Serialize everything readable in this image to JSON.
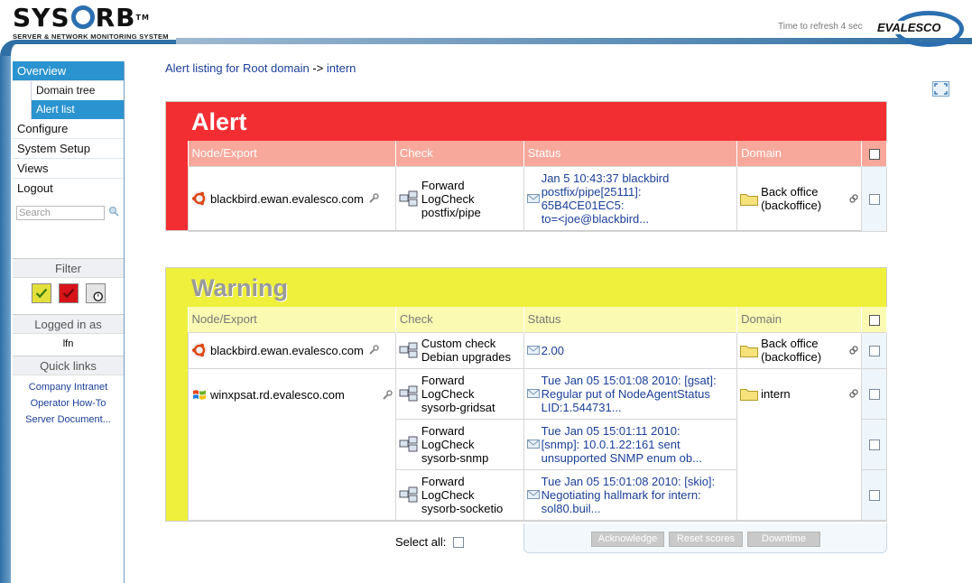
{
  "header": {
    "brand_left": "SYS",
    "brand_right": "RB",
    "trademark": "TM",
    "subtitle": "SERVER & NETWORK MONITORING SYSTEM",
    "refresh_text": "Time to refresh 4 sec",
    "partner": "EVALESCO"
  },
  "sidebar": {
    "nav": [
      {
        "label": "Overview"
      },
      {
        "label": "Domain tree"
      },
      {
        "label": "Alert list"
      },
      {
        "label": "Configure"
      },
      {
        "label": "System Setup"
      },
      {
        "label": "Views"
      },
      {
        "label": "Logout"
      }
    ],
    "search_placeholder": "Search",
    "filter_title": "Filter",
    "logged_in_title": "Logged in as",
    "logged_in_user": "lfn",
    "quick_links_title": "Quick links",
    "quick_links": [
      "Company Intranet",
      "Operator How-To",
      "Server Document..."
    ]
  },
  "breadcrumb": {
    "prefix": "Alert listing for Root domain",
    "sep": "->",
    "current": "intern"
  },
  "columns": {
    "node": "Node/Export",
    "check": "Check",
    "status": "Status",
    "domain": "Domain"
  },
  "alert": {
    "title": "Alert",
    "rows": [
      {
        "node": "blackbird.ewan.evalesco.com",
        "check": [
          "Forward",
          "LogCheck",
          "postfix/pipe"
        ],
        "status": [
          "Jan 5 10:43:37 blackbird",
          "postfix/pipe[25111]:",
          "65B4CE01EC5:",
          "to=<joe@blackbird..."
        ],
        "domain": [
          "Back office",
          "(backoffice)"
        ]
      }
    ]
  },
  "warning": {
    "title": "Warning",
    "rows": [
      {
        "node": "blackbird.ewan.evalesco.com",
        "check": [
          "Custom check",
          "Debian upgrades"
        ],
        "status": [
          "2.00"
        ],
        "domain": [
          "Back office",
          "(backoffice)"
        ]
      },
      {
        "node": "winxpsat.rd.evalesco.com",
        "domain": [
          "intern"
        ],
        "checks": [
          {
            "check": [
              "Forward",
              "LogCheck",
              "sysorb-gridsat"
            ],
            "status": [
              "Tue Jan 05 15:01:08 2010: [gsat]:",
              "Regular put of NodeAgentStatus",
              "LID:1.544731..."
            ]
          },
          {
            "check": [
              "Forward",
              "LogCheck",
              "sysorb-snmp"
            ],
            "status": [
              "Tue Jan 05 15:01:11 2010:",
              "[snmp]: 10.0.1.22:161 sent",
              "unsupported SNMP enum ob..."
            ]
          },
          {
            "check": [
              "Forward",
              "LogCheck",
              "sysorb-socketio"
            ],
            "status": [
              "Tue Jan 05 15:01:08 2010: [skio]:",
              "Negotiating hallmark for intern:",
              "sol80.buil..."
            ]
          }
        ]
      }
    ]
  },
  "footer": {
    "select_all": "Select all:",
    "buttons": [
      "Acknowledge",
      "Reset scores",
      "Downtime"
    ]
  },
  "colors": {
    "alert": "#f22e33",
    "warning": "#eef03c",
    "accent": "#2b93cf",
    "link": "#1a3f99"
  }
}
